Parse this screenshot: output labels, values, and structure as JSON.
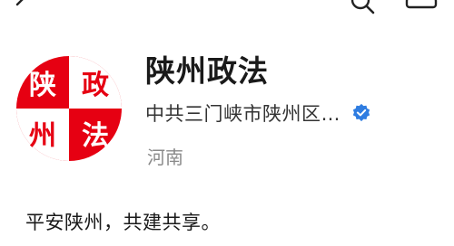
{
  "header": {
    "back_icon": "chevron-left-icon",
    "search_icon": "search-icon",
    "more_icon": "more-icon"
  },
  "profile": {
    "logo": {
      "chars": [
        "陕",
        "政",
        "州",
        "法"
      ],
      "primary_color": "#e60012",
      "secondary_color": "#ffffff"
    },
    "name": "陕州政法",
    "organization": "中共三门峡市陕州区…",
    "verified_icon": "verified-badge-icon",
    "verified_color": "#2f7de1",
    "location": "河南",
    "bio": "平安陕州，共建共享。"
  }
}
